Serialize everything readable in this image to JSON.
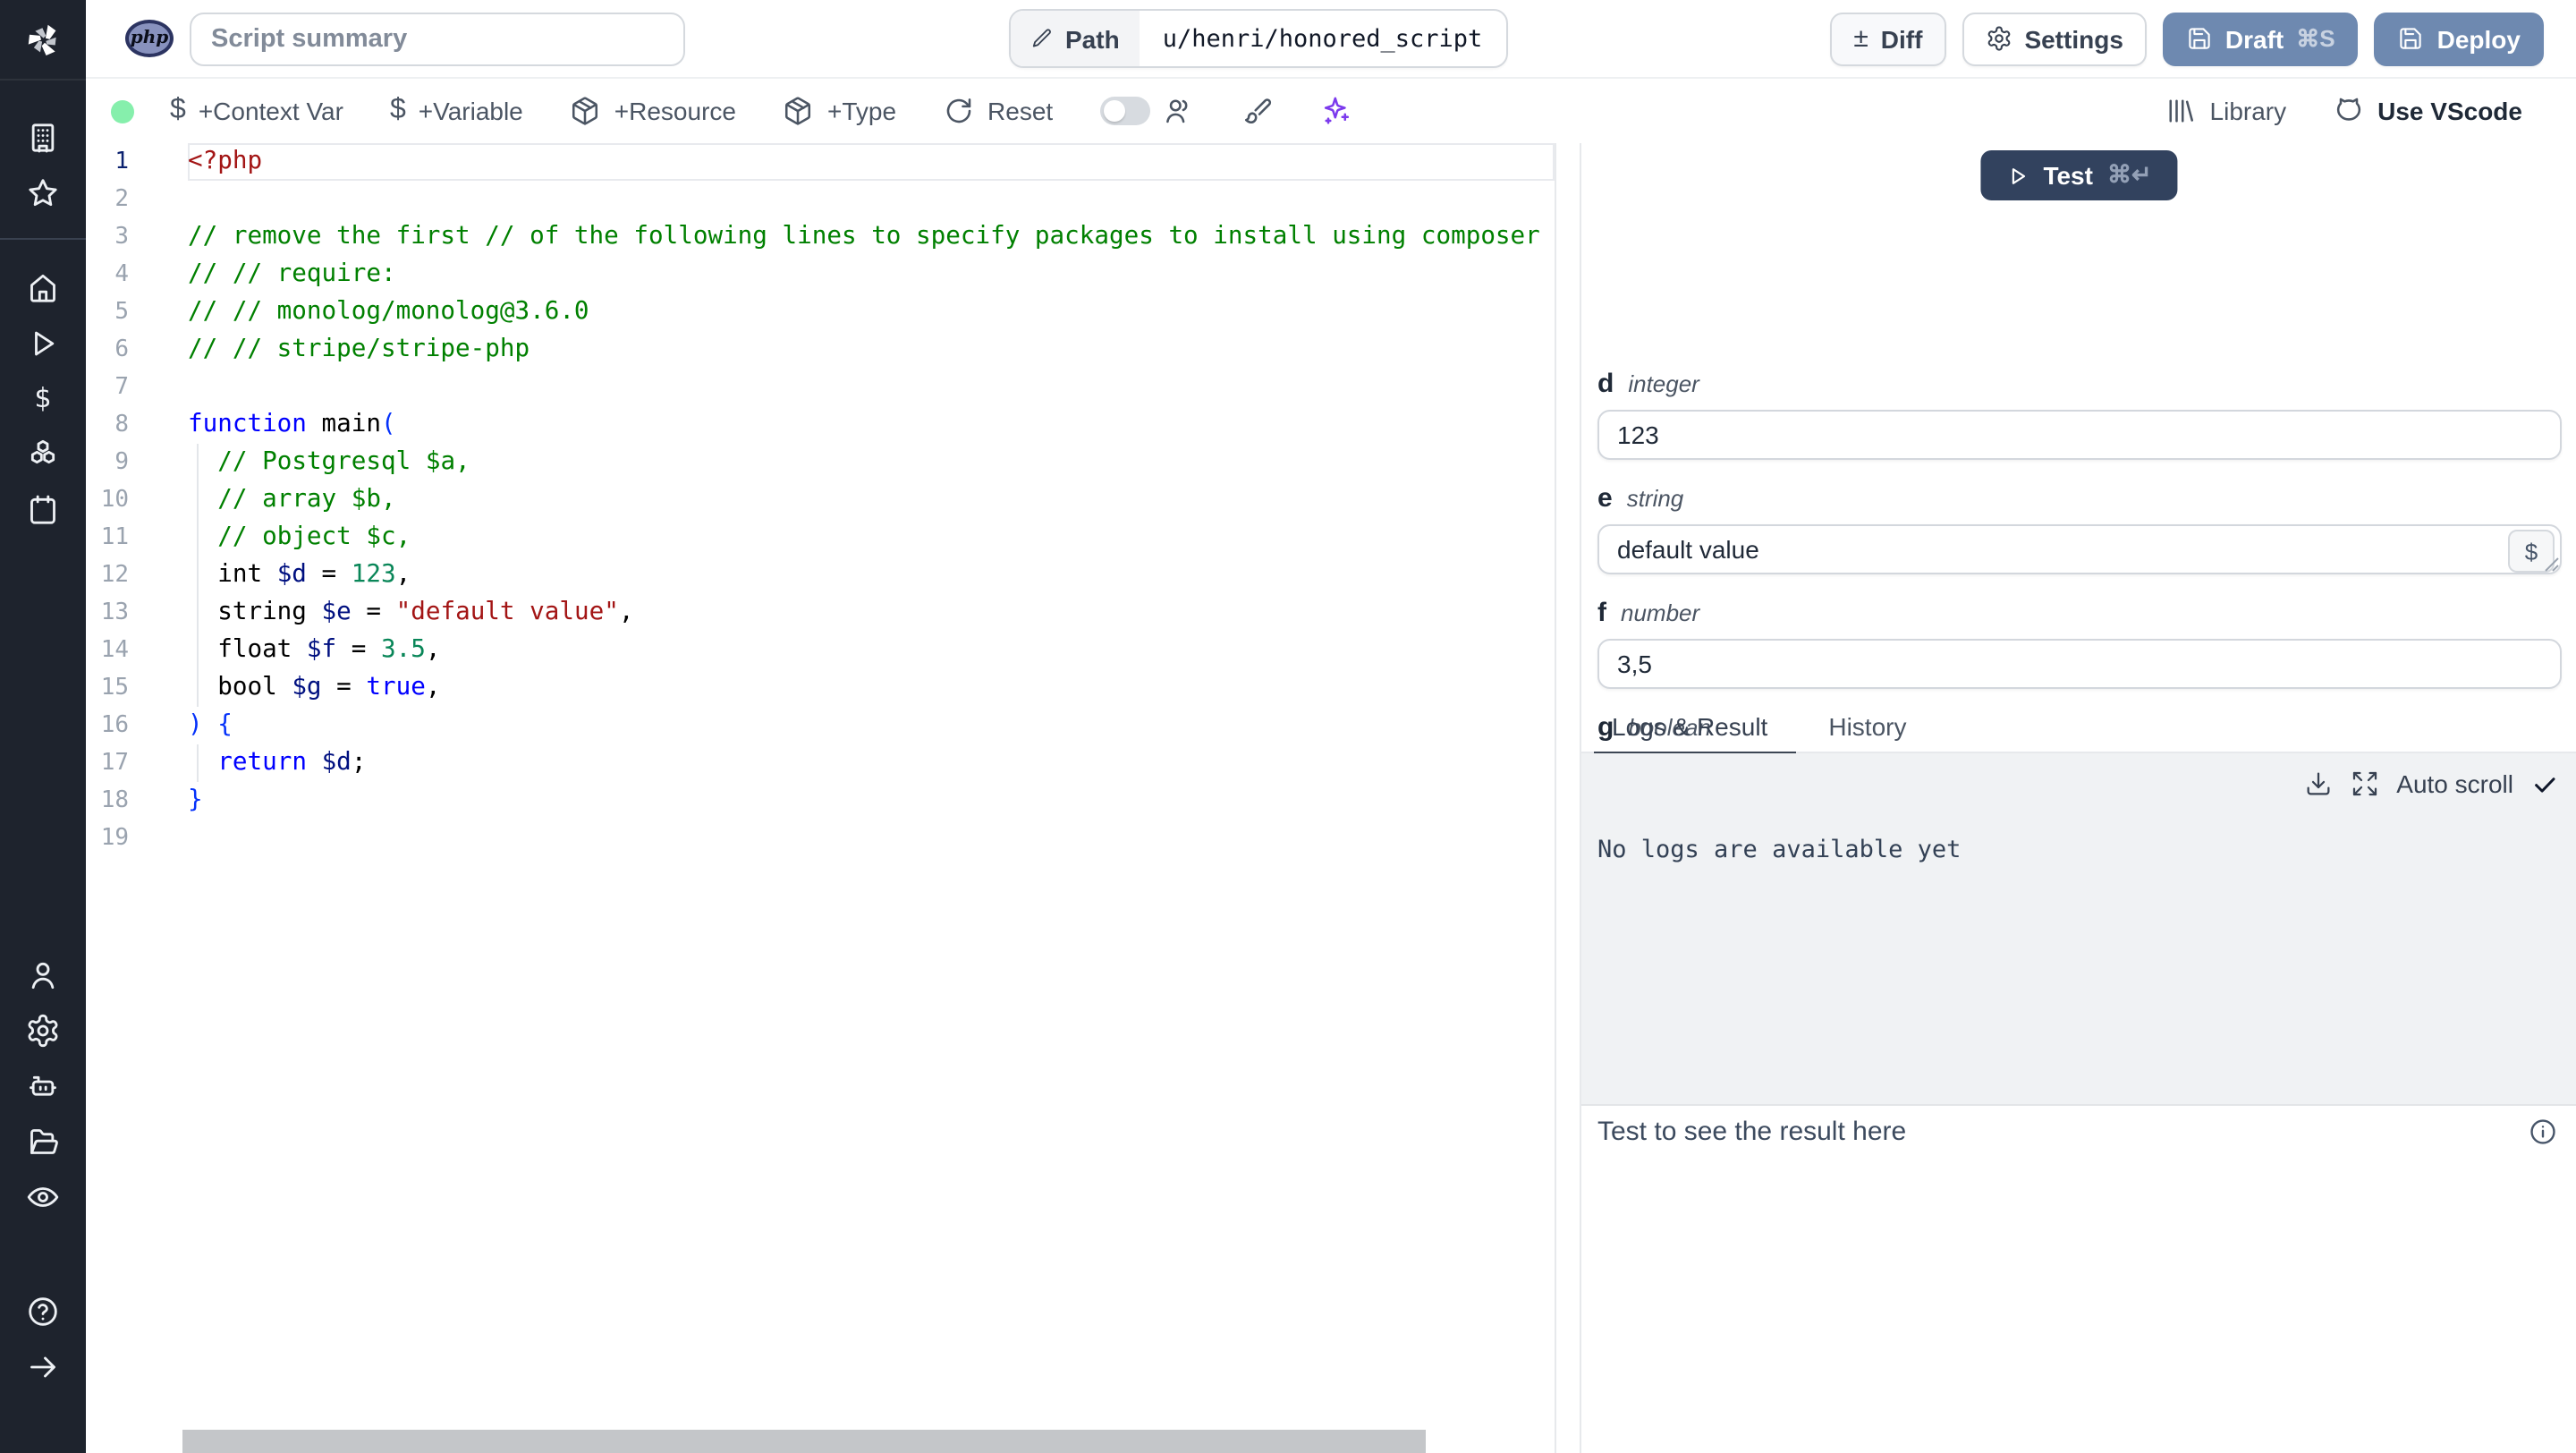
{
  "topbar": {
    "language_badge": "php",
    "summary_placeholder": "Script summary",
    "path_label": "Path",
    "path_value": "u/henri/honored_script",
    "diff_glyph": "±",
    "diff_label": "Diff",
    "settings_label": "Settings",
    "draft_label": "Draft",
    "draft_shortcut": "⌘S",
    "deploy_label": "Deploy"
  },
  "toolbar": {
    "dollar_glyph": "$",
    "context_var_label": "+Context Var",
    "variable_label": "+Variable",
    "resource_label": "+Resource",
    "type_label": "+Type",
    "reset_label": "Reset",
    "library_label": "Library",
    "vscode_label": "Use VScode"
  },
  "editor": {
    "active_line": 1,
    "guide_lines": [
      9,
      10,
      11,
      12,
      13,
      14,
      15,
      17
    ],
    "lines": [
      [
        [
          "<?php",
          "tag"
        ]
      ],
      [],
      [
        [
          "// remove the first // of the following lines to specify packages to install using composer",
          "cm"
        ]
      ],
      [
        [
          "// // require:",
          "cm"
        ]
      ],
      [
        [
          "// // monolog/monolog@3.6.0",
          "cm"
        ]
      ],
      [
        [
          "// // stripe/stripe-php",
          "cm"
        ]
      ],
      [],
      [
        [
          "function",
          "kw"
        ],
        [
          " ",
          "pl"
        ],
        [
          "main",
          "fn"
        ],
        [
          "(",
          "br"
        ]
      ],
      [
        [
          "  ",
          "pl"
        ],
        [
          "// Postgresql $a,",
          "cm"
        ]
      ],
      [
        [
          "  ",
          "pl"
        ],
        [
          "// array $b,",
          "cm"
        ]
      ],
      [
        [
          "  ",
          "pl"
        ],
        [
          "// object $c,",
          "cm"
        ]
      ],
      [
        [
          "  int ",
          "pl"
        ],
        [
          "$d",
          "vr"
        ],
        [
          " = ",
          "pl"
        ],
        [
          "123",
          "nm"
        ],
        [
          ",",
          "pl"
        ]
      ],
      [
        [
          "  string ",
          "pl"
        ],
        [
          "$e",
          "vr"
        ],
        [
          " = ",
          "pl"
        ],
        [
          "\"default value\"",
          "str"
        ],
        [
          ",",
          "pl"
        ]
      ],
      [
        [
          "  float ",
          "pl"
        ],
        [
          "$f",
          "vr"
        ],
        [
          " = ",
          "pl"
        ],
        [
          "3.5",
          "nm"
        ],
        [
          ",",
          "pl"
        ]
      ],
      [
        [
          "  bool ",
          "pl"
        ],
        [
          "$g",
          "vr"
        ],
        [
          " = ",
          "pl"
        ],
        [
          "true",
          "kw"
        ],
        [
          ",",
          "pl"
        ]
      ],
      [
        [
          ") {",
          "br"
        ]
      ],
      [
        [
          "  ",
          "pl"
        ],
        [
          "return",
          "kw"
        ],
        [
          " ",
          "pl"
        ],
        [
          "$d",
          "vr"
        ],
        [
          ";",
          "pl"
        ]
      ],
      [
        [
          "}",
          "br"
        ]
      ],
      []
    ]
  },
  "right_panel": {
    "test_label": "Test",
    "test_shortcut": "⌘↵",
    "args": [
      {
        "name": "d",
        "type": "integer",
        "value": "123"
      },
      {
        "name": "e",
        "type": "string",
        "value": "default value",
        "dollar_button": "$"
      },
      {
        "name": "f",
        "type": "number",
        "value": "3,5"
      },
      {
        "name": "g",
        "type": "boolean",
        "value": true
      }
    ],
    "tabs": [
      "Logs & Result",
      "History"
    ],
    "auto_scroll_label": "Auto scroll",
    "no_logs_text": "No logs are available yet",
    "result_placeholder": "Test to see the result here"
  },
  "colors": {
    "sidebar_bg": "#1e232d",
    "primary_button": "#6e89b0",
    "test_button": "#32425e",
    "toggle_on": "#3b63e3",
    "status_dot": "#86efac",
    "ai_accent": "#7c3aed"
  }
}
